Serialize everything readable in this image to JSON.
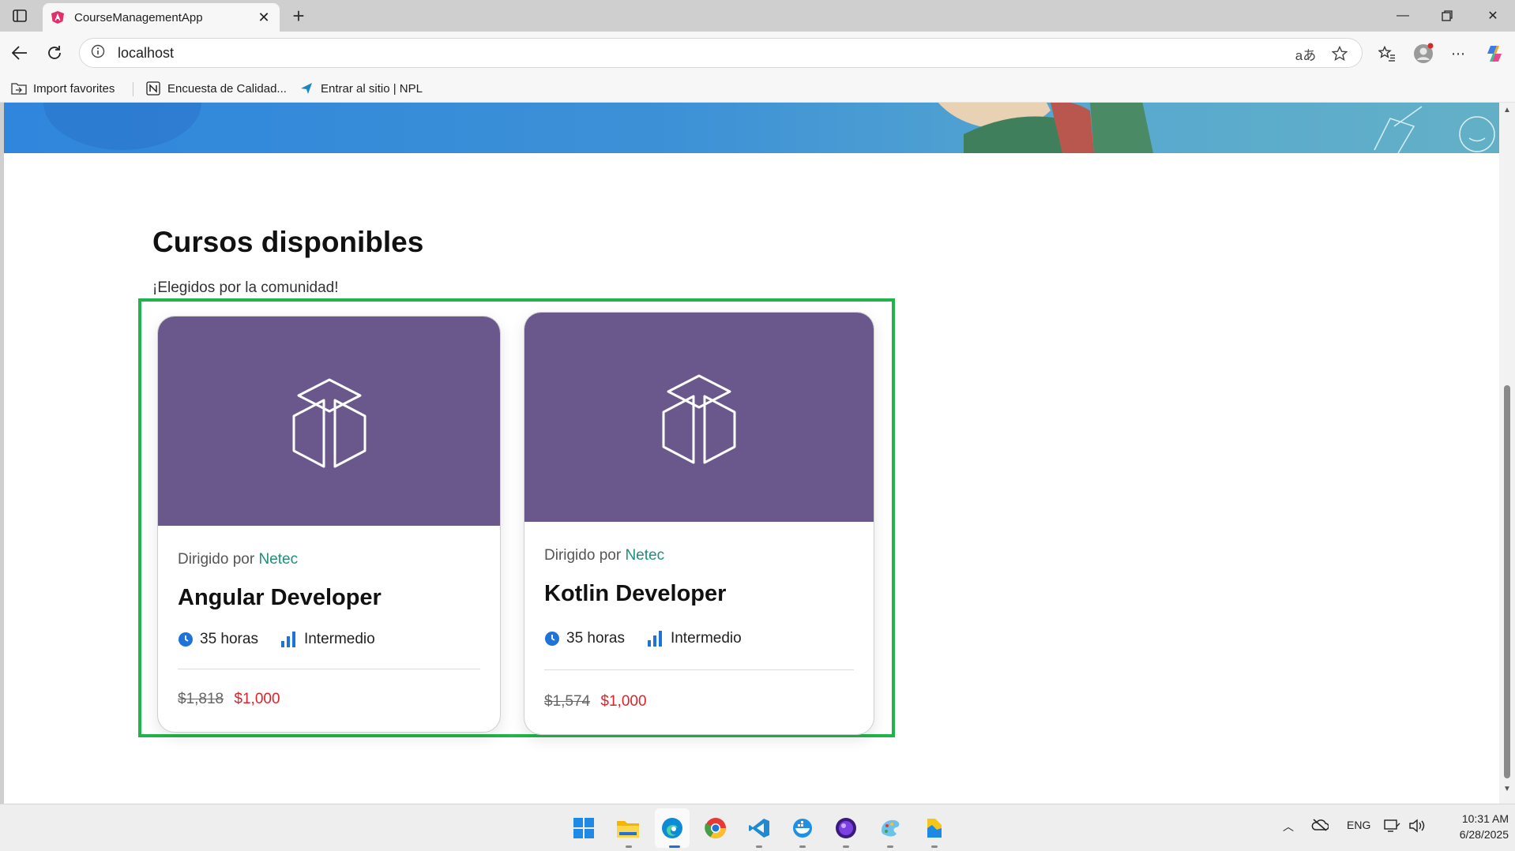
{
  "browser": {
    "tab_title": "CourseManagementApp",
    "new_tab_symbol": "+",
    "url": "localhost",
    "bookmarks": [
      {
        "label": "Import favorites",
        "icon": "folder-import-icon"
      },
      {
        "label": "Encuesta de Calidad...",
        "icon": "notion-icon"
      },
      {
        "label": "Entrar al sitio | NPL",
        "icon": "npl-arrow-icon"
      }
    ]
  },
  "page": {
    "section_title": "Cursos disponibles",
    "section_subtitle": "¡Elegidos por la comunidad!",
    "courses": [
      {
        "directed_by_label": "Dirigido por",
        "organization": "Netec",
        "title": "Angular Developer",
        "duration": "35 horas",
        "level": "Intermedio",
        "old_price": "$1,818",
        "price": "$1,000",
        "image_icon": "cube-icon"
      },
      {
        "directed_by_label": "Dirigido por",
        "organization": "Netec",
        "title": "Kotlin Developer",
        "duration": "35 horas",
        "level": "Intermedio",
        "old_price": "$1,574",
        "price": "$1,000",
        "image_icon": "cube-icon"
      }
    ]
  },
  "taskbar": {
    "language": "ENG",
    "time": "10:31 AM",
    "date": "6/28/2025",
    "apps": [
      "windows-start-icon",
      "file-explorer-icon",
      "edge-icon",
      "chrome-icon",
      "vscode-icon",
      "docker-icon",
      "app-purple-icon",
      "paint-icon",
      "folder-app-icon"
    ]
  },
  "colors": {
    "card_media": "#6a588c",
    "highlight_border": "#22b44c",
    "price_red": "#e0222a",
    "org_teal": "#1f8f7a",
    "meta_blue": "#1e73d8"
  }
}
